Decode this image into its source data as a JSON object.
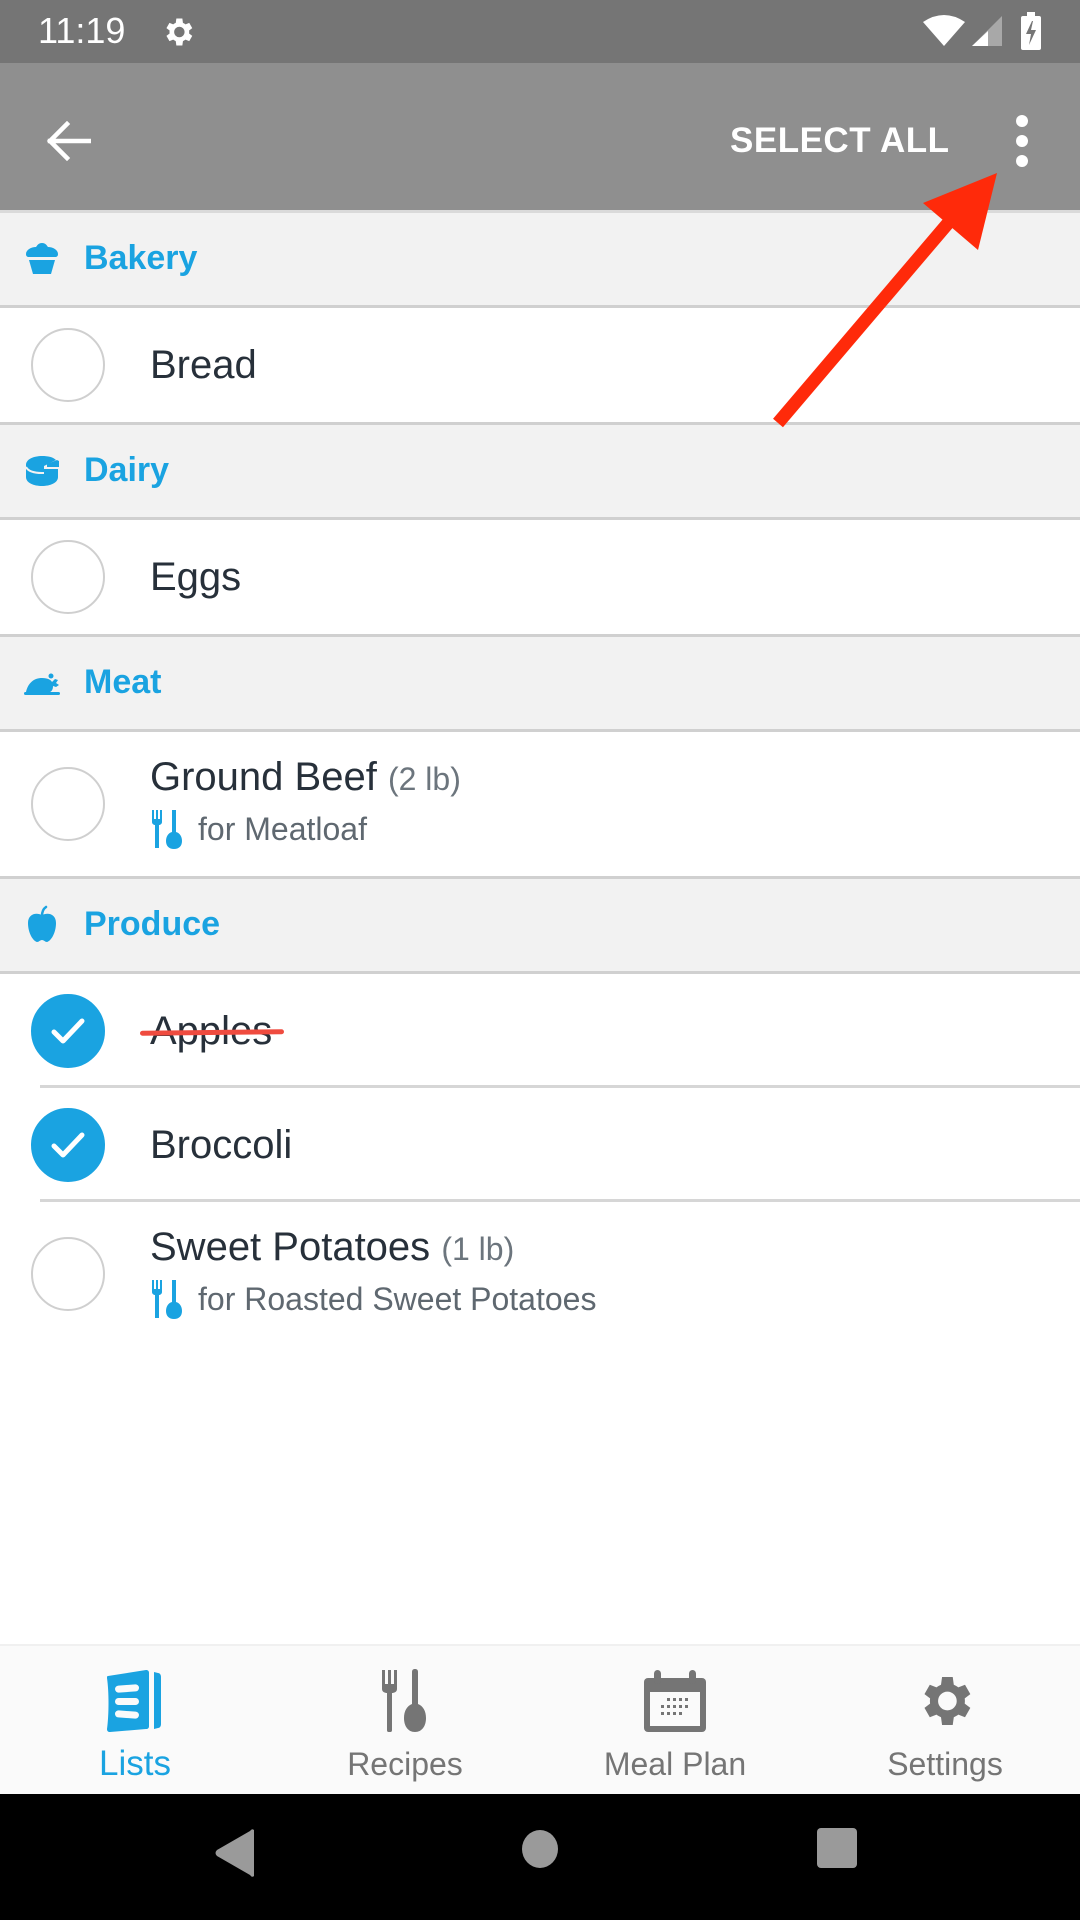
{
  "status_bar": {
    "time": "11:19",
    "icons": [
      "settings-gear-icon",
      "wifi-icon",
      "cell-signal-icon",
      "battery-charging-icon"
    ]
  },
  "app_bar": {
    "back_icon": "arrow-left-icon",
    "select_all_label": "SELECT ALL",
    "overflow_icon": "more-vert-icon"
  },
  "sections": [
    {
      "title": "Bakery",
      "icon": "cupcake-icon",
      "items": [
        {
          "name": "Bread",
          "quantity": "",
          "recipe": "",
          "checked": false
        }
      ]
    },
    {
      "title": "Dairy",
      "icon": "cheese-icon",
      "items": [
        {
          "name": "Eggs",
          "quantity": "",
          "recipe": "",
          "checked": false
        }
      ]
    },
    {
      "title": "Meat",
      "icon": "roast-chicken-icon",
      "items": [
        {
          "name": "Ground Beef",
          "quantity": "(2 lb)",
          "recipe": "for Meatloaf",
          "checked": false
        }
      ]
    },
    {
      "title": "Produce",
      "icon": "apple-icon",
      "items": [
        {
          "name": "Apples",
          "quantity": "",
          "recipe": "",
          "checked": true,
          "struck": true
        },
        {
          "name": "Broccoli",
          "quantity": "",
          "recipe": "",
          "checked": true,
          "struck": false
        },
        {
          "name": "Sweet Potatoes",
          "quantity": "(1 lb)",
          "recipe": "for Roasted Sweet Potatoes",
          "checked": false
        }
      ]
    }
  ],
  "bottom_nav": {
    "items": [
      {
        "label": "Lists",
        "icon": "lists-icon",
        "active": true
      },
      {
        "label": "Recipes",
        "icon": "fork-spoon-icon",
        "active": false
      },
      {
        "label": "Meal Plan",
        "icon": "calendar-icon",
        "active": false
      },
      {
        "label": "Settings",
        "icon": "settings-gear-icon",
        "active": false
      }
    ]
  },
  "system_nav": {
    "icons": [
      "nav-back-icon",
      "nav-home-icon",
      "nav-recents-icon"
    ]
  },
  "colors": {
    "accent": "#1aa3e1",
    "app_bar": "#8f8f8f",
    "status_bar": "#757575",
    "annotation_arrow": "#ff2a0a",
    "strike": "#ef4b3f"
  }
}
